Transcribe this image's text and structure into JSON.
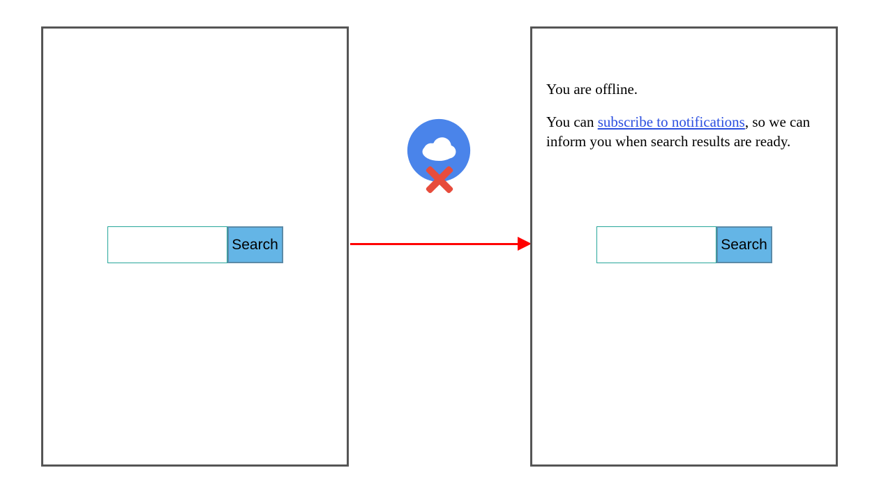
{
  "left_panel": {
    "search": {
      "button_label": "Search",
      "input_value": ""
    }
  },
  "right_panel": {
    "search": {
      "button_label": "Search",
      "input_value": ""
    },
    "message": {
      "line1": "You are offline.",
      "line2_before": "You can ",
      "line2_link": "subscribe to notifications",
      "line2_after": ", so we can inform you when search results are ready."
    }
  },
  "icon": {
    "name": "cloud-offline"
  }
}
